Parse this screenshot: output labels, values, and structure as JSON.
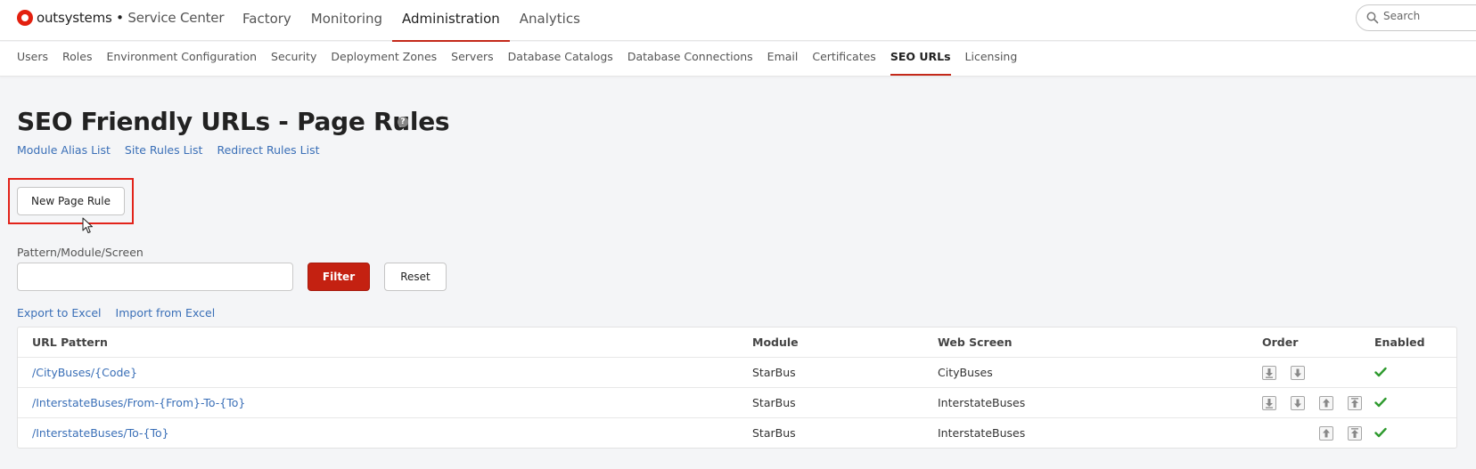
{
  "app": {
    "brand": "outsystems",
    "separator": " • ",
    "product": "Service Center"
  },
  "main_nav": [
    {
      "label": "Factory",
      "active": false
    },
    {
      "label": "Monitoring",
      "active": false
    },
    {
      "label": "Administration",
      "active": true
    },
    {
      "label": "Analytics",
      "active": false
    }
  ],
  "search": {
    "placeholder": "Search"
  },
  "sub_nav": [
    {
      "label": "Users",
      "active": false
    },
    {
      "label": "Roles",
      "active": false
    },
    {
      "label": "Environment Configuration",
      "active": false
    },
    {
      "label": "Security",
      "active": false
    },
    {
      "label": "Deployment Zones",
      "active": false
    },
    {
      "label": "Servers",
      "active": false
    },
    {
      "label": "Database Catalogs",
      "active": false
    },
    {
      "label": "Database Connections",
      "active": false
    },
    {
      "label": "Email",
      "active": false
    },
    {
      "label": "Certificates",
      "active": false
    },
    {
      "label": "SEO URLs",
      "active": true
    },
    {
      "label": "Licensing",
      "active": false
    }
  ],
  "page": {
    "title": "SEO Friendly URLs - Page Rules",
    "help_glyph": "?",
    "links": [
      "Module Alias List",
      "Site Rules List",
      "Redirect Rules List"
    ],
    "new_button_label": "New Page Rule"
  },
  "filter": {
    "label": "Pattern/Module/Screen",
    "value": "",
    "filter_label": "Filter",
    "reset_label": "Reset"
  },
  "excel": {
    "export_label": "Export to Excel",
    "import_label": "Import from Excel"
  },
  "table": {
    "headers": {
      "url_pattern": "URL Pattern",
      "module": "Module",
      "web_screen": "Web Screen",
      "order": "Order",
      "enabled": "Enabled"
    },
    "rows": [
      {
        "url_pattern": "/CityBuses/{Code}",
        "module": "StarBus",
        "web_screen": "CityBuses",
        "order_buttons": [
          "move-to-bottom",
          "move-down"
        ],
        "enabled": true
      },
      {
        "url_pattern": "/InterstateBuses/From-{From}-To-{To}",
        "module": "StarBus",
        "web_screen": "InterstateBuses",
        "order_buttons": [
          "move-to-bottom",
          "move-down",
          "move-up",
          "move-to-top"
        ],
        "enabled": true
      },
      {
        "url_pattern": "/InterstateBuses/To-{To}",
        "module": "StarBus",
        "web_screen": "InterstateBuses",
        "order_buttons": [
          "move-up",
          "move-to-top"
        ],
        "enabled": true
      }
    ]
  },
  "colors": {
    "accent": "#c42111",
    "link": "#3a6fb7",
    "highlight_box": "#e2231a",
    "enabled_check": "#2e9a2e"
  }
}
